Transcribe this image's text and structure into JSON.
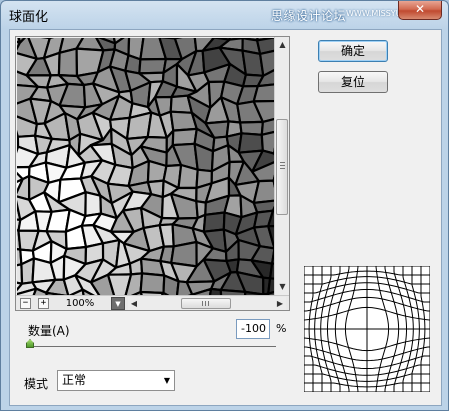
{
  "window": {
    "title": "球面化",
    "watermark": "思缘设计论坛",
    "watermark_site": "WWW.MISSYUAN.COM",
    "close_glyph": "✕"
  },
  "buttons": {
    "ok_label": "确定",
    "reset_label": "复位"
  },
  "preview": {
    "zoom_out_glyph": "−",
    "zoom_in_glyph": "+",
    "zoom_value": "100%",
    "scroll_up_glyph": "▲",
    "scroll_down_glyph": "▼",
    "scroll_left_glyph": "◀",
    "scroll_right_glyph": "▶",
    "dropdown_glyph": "▼"
  },
  "amount": {
    "label": "数量(A)",
    "value": "-100",
    "unit": "%",
    "slider_fraction": 0.0
  },
  "mode": {
    "label": "模式",
    "selected": "正常",
    "arrow_glyph": "▼"
  },
  "colors": {
    "title_bar": "#bcd3e8",
    "close_button": "#c04a30",
    "client_bg": "#f0f0f0",
    "default_button_border": "#3c7fb1",
    "slider_handle": "#4f9a2a"
  }
}
